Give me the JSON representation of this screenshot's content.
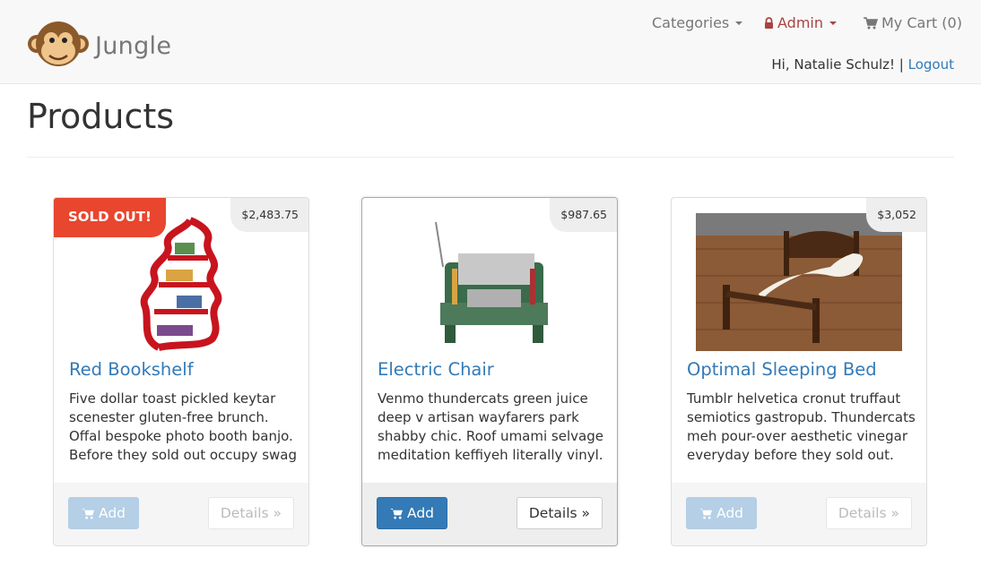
{
  "brand": {
    "name": "Jungle",
    "logo_icon": "monkey-face-icon"
  },
  "nav": {
    "categories_label": "Categories",
    "admin_label": "Admin",
    "cart_label": "My Cart (0)",
    "greeting": "Hi, Natalie Schulz! |",
    "logout_label": "Logout"
  },
  "page": {
    "title": "Products"
  },
  "products": [
    {
      "name": "Red Bookshelf",
      "price": "$2,483.75",
      "badge": "SOLD OUT!",
      "description": "Five dollar toast pickled keytar scenester gluten-free brunch. Offal bespoke photo booth banjo. Before they sold out occupy swag",
      "add_label": "Add",
      "details_label": "Details »",
      "image_icon": "red-bookshelf-image"
    },
    {
      "name": "Electric Chair",
      "price": "$987.65",
      "description": "Venmo thundercats green juice deep v artisan wayfarers park shabby chic. Roof umami selvage meditation keffiyeh literally vinyl.",
      "add_label": "Add",
      "details_label": "Details »",
      "image_icon": "circuit-chair-image"
    },
    {
      "name": "Optimal Sleeping Bed",
      "price": "$3,052",
      "description": "Tumblr helvetica cronut truffaut semiotics gastropub. Thundercats meh pour-over aesthetic vinegar everyday before they sold out.",
      "add_label": "Add",
      "details_label": "Details »",
      "image_icon": "wooden-bed-image"
    }
  ],
  "colors": {
    "link": "#337ab7",
    "sold_badge": "#e8462e",
    "admin": "#a94442",
    "navbar_bg": "#f8f8f8"
  }
}
